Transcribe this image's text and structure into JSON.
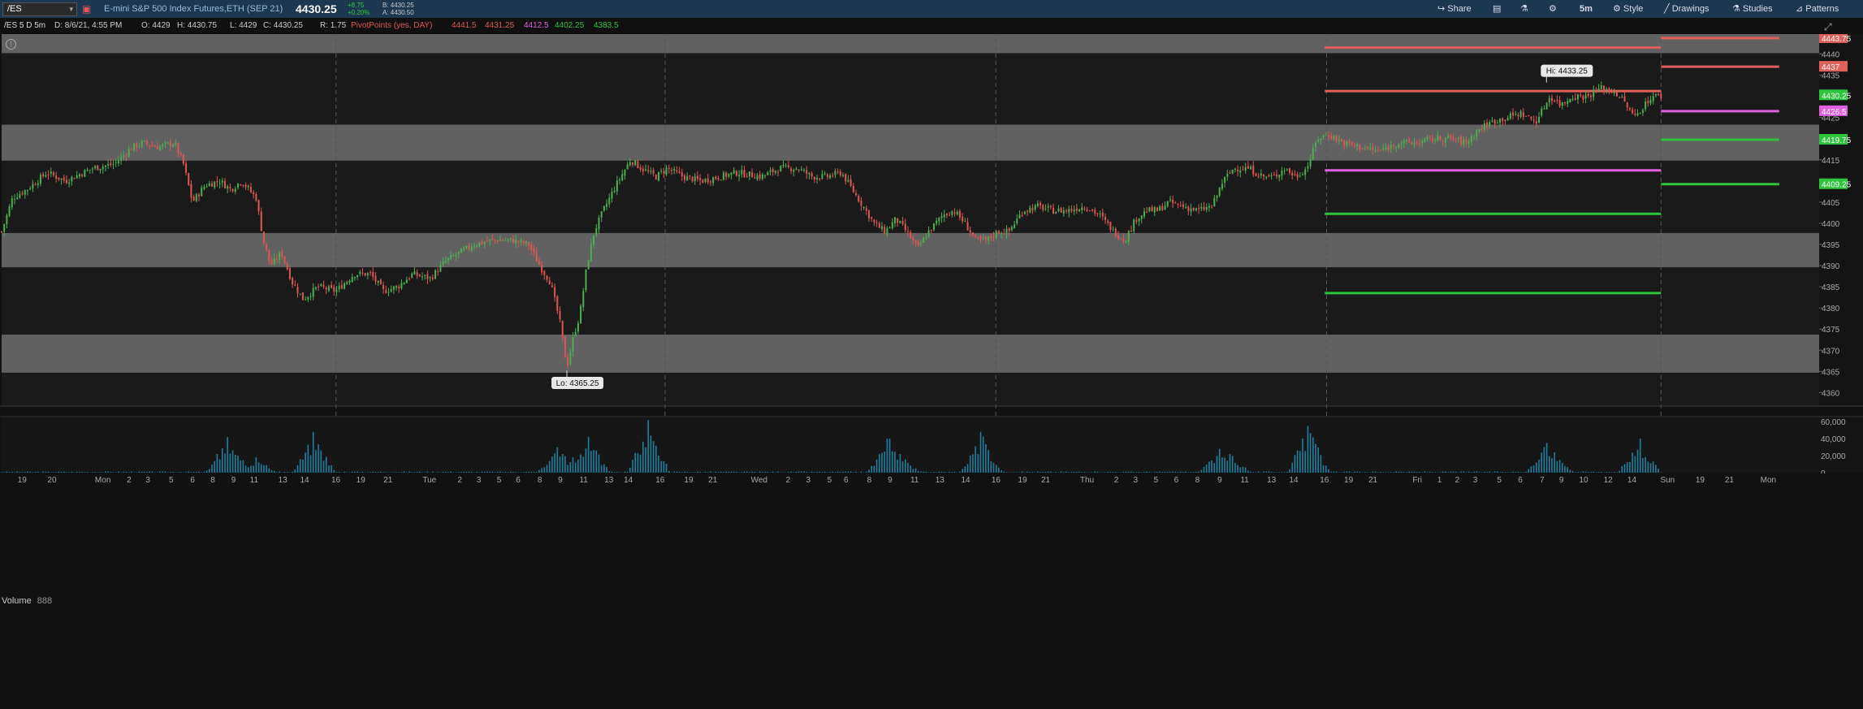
{
  "toolbar": {
    "symbol": "/ES",
    "description": "E-mini S&P 500 Index Futures,ETH (SEP 21)",
    "last_price": "4430.25",
    "net_change": "+8.75",
    "pct_change": "+0.20%",
    "bid": "B: 4430.25",
    "ask": "A: 4430.50",
    "buttons": [
      "Share",
      "5m",
      "Style",
      "Drawings",
      "Studies",
      "Patterns"
    ]
  },
  "infobar": {
    "chart_title": "/ES 5 D 5m",
    "date": "D: 8/6/21, 4:55 PM",
    "open": "O: 4429",
    "high": "H: 4430.75",
    "low": "L: 4429",
    "close": "C: 4430.25",
    "range": "R: 1.75",
    "study": "PivotPoints (yes, DAY)",
    "pivots": [
      "4441.5",
      "4431.25",
      "4412.5",
      "4402.25",
      "4383.5"
    ]
  },
  "volume": {
    "label": "Volume",
    "value": "888"
  },
  "colors": {
    "background": "#111111",
    "band": "#7a7a7a",
    "up": "#4caf50",
    "down": "#e05555",
    "resistance": "#e0605a",
    "pivot": "#e060e0",
    "support": "#2ec43c",
    "volume": "#1f7fa0",
    "toolbar": "#1c3750"
  },
  "chart_data": {
    "type": "candlestick",
    "ylim": [
      4357,
      4447
    ],
    "y_ticks": [
      "4440",
      "4435",
      "4430",
      "4425",
      "4420",
      "4415",
      "4410",
      "4405",
      "4400",
      "4395",
      "4390",
      "4385",
      "4380",
      "4375",
      "4370",
      "4365",
      "4360"
    ],
    "x_ticks": [
      {
        "label": "19",
        "x": 0.0113
      },
      {
        "label": "20",
        "x": 0.0277
      },
      {
        "label": "Mon",
        "x": 0.0557
      },
      {
        "label": "2",
        "x": 0.0701
      },
      {
        "label": "3",
        "x": 0.0805
      },
      {
        "label": "5",
        "x": 0.0933
      },
      {
        "label": "6",
        "x": 0.1051
      },
      {
        "label": "8",
        "x": 0.1162
      },
      {
        "label": "9",
        "x": 0.1276
      },
      {
        "label": "11",
        "x": 0.1389
      },
      {
        "label": "13",
        "x": 0.1547
      },
      {
        "label": "14",
        "x": 0.1667
      },
      {
        "label": "16",
        "x": 0.1839
      },
      {
        "label": "19",
        "x": 0.1976
      },
      {
        "label": "21",
        "x": 0.2126
      },
      {
        "label": "Tue",
        "x": 0.2354
      },
      {
        "label": "2",
        "x": 0.2521
      },
      {
        "label": "3",
        "x": 0.2626
      },
      {
        "label": "5",
        "x": 0.2737
      },
      {
        "label": "6",
        "x": 0.2842
      },
      {
        "label": "8",
        "x": 0.2961
      },
      {
        "label": "9",
        "x": 0.3074
      },
      {
        "label": "11",
        "x": 0.3202
      },
      {
        "label": "13",
        "x": 0.3341
      },
      {
        "label": "14",
        "x": 0.3448
      },
      {
        "label": "16",
        "x": 0.3623
      },
      {
        "label": "19",
        "x": 0.378
      },
      {
        "label": "21",
        "x": 0.3913
      },
      {
        "label": "Wed",
        "x": 0.4168
      },
      {
        "label": "2",
        "x": 0.4327
      },
      {
        "label": "3",
        "x": 0.4438
      },
      {
        "label": "5",
        "x": 0.4555
      },
      {
        "label": "6",
        "x": 0.4646
      },
      {
        "label": "8",
        "x": 0.4774
      },
      {
        "label": "9",
        "x": 0.4888
      },
      {
        "label": "11",
        "x": 0.5023
      },
      {
        "label": "13",
        "x": 0.5162
      },
      {
        "label": "14",
        "x": 0.5304
      },
      {
        "label": "16",
        "x": 0.5471
      },
      {
        "label": "19",
        "x": 0.5617
      },
      {
        "label": "21",
        "x": 0.5744
      },
      {
        "label": "Thu",
        "x": 0.5972
      },
      {
        "label": "2",
        "x": 0.6133
      },
      {
        "label": "3",
        "x": 0.6239
      },
      {
        "label": "5",
        "x": 0.6351
      },
      {
        "label": "6",
        "x": 0.6463
      },
      {
        "label": "8",
        "x": 0.6579
      },
      {
        "label": "9",
        "x": 0.6702
      },
      {
        "label": "11",
        "x": 0.6839
      },
      {
        "label": "13",
        "x": 0.6987
      },
      {
        "label": "14",
        "x": 0.7109
      },
      {
        "label": "16",
        "x": 0.7278
      },
      {
        "label": "19",
        "x": 0.7411
      },
      {
        "label": "21",
        "x": 0.7545
      },
      {
        "label": "Fri",
        "x": 0.7789
      },
      {
        "label": "1",
        "x": 0.7911
      },
      {
        "label": "2",
        "x": 0.8009
      },
      {
        "label": "3",
        "x": 0.8108
      },
      {
        "label": "5",
        "x": 0.824
      },
      {
        "label": "6",
        "x": 0.8356
      },
      {
        "label": "7",
        "x": 0.8476
      },
      {
        "label": "9",
        "x": 0.8582
      },
      {
        "label": "10",
        "x": 0.8704
      },
      {
        "label": "12",
        "x": 0.8839
      },
      {
        "label": "14",
        "x": 0.897
      },
      {
        "label": "Sun",
        "x": 0.9166
      },
      {
        "label": "19",
        "x": 0.9345
      },
      {
        "label": "21",
        "x": 0.9506
      },
      {
        "label": "Mon",
        "x": 0.972
      }
    ],
    "session_dividers": [
      0.184,
      0.365,
      0.547,
      0.729,
      0.913
    ],
    "gray_bands": [
      [
        4440.2,
        4447
      ],
      [
        4414.8,
        4423.3
      ],
      [
        4389.6,
        4397.7
      ],
      [
        4364.7,
        4373.7
      ]
    ],
    "pivot_lines": [
      {
        "value": 4441.5,
        "role": "resistance",
        "x0": 0.728,
        "x1": 0.913
      },
      {
        "value": 4431.25,
        "role": "resistance",
        "x0": 0.728,
        "x1": 0.913
      },
      {
        "value": 4412.5,
        "role": "pivot",
        "x0": 0.728,
        "x1": 0.913
      },
      {
        "value": 4402.25,
        "role": "support",
        "x0": 0.728,
        "x1": 0.913
      },
      {
        "value": 4383.5,
        "role": "support",
        "x0": 0.728,
        "x1": 0.913
      },
      {
        "value": 4443.75,
        "role": "resistance",
        "x0": 0.913,
        "x1": 0.978
      },
      {
        "value": 4437,
        "role": "resistance",
        "x0": 0.913,
        "x1": 0.978
      },
      {
        "value": 4426.5,
        "role": "pivot",
        "x0": 0.913,
        "x1": 0.978
      },
      {
        "value": 4419.75,
        "role": "support",
        "x0": 0.913,
        "x1": 0.978
      },
      {
        "value": 4409.25,
        "role": "support",
        "x0": 0.913,
        "x1": 0.978
      }
    ],
    "price_flags": [
      {
        "label": "4443.75",
        "value": 4443.75,
        "role": "resistance"
      },
      {
        "label": "4437",
        "value": 4437,
        "role": "resistance"
      },
      {
        "label": "4430.25",
        "value": 4430.25,
        "role": "support"
      },
      {
        "label": "4426.5",
        "value": 4426.5,
        "role": "pivot"
      },
      {
        "label": "4419.75",
        "value": 4419.75,
        "role": "support"
      },
      {
        "label": "4409.25",
        "value": 4409.25,
        "role": "support"
      }
    ],
    "annotations": [
      {
        "text": "Hi: 4433.25",
        "x": 0.85,
        "value": 4433.25
      },
      {
        "text": "Lo: 4365.25",
        "x": 0.311,
        "value": 4365.25
      }
    ],
    "price_path": [
      [
        0.0,
        4398
      ],
      [
        0.006,
        4406
      ],
      [
        0.014,
        4408
      ],
      [
        0.025,
        4412
      ],
      [
        0.035,
        4410
      ],
      [
        0.05,
        4413
      ],
      [
        0.062,
        4414
      ],
      [
        0.072,
        4418
      ],
      [
        0.078,
        4419
      ],
      [
        0.086,
        4418
      ],
      [
        0.095,
        4419
      ],
      [
        0.1,
        4414
      ],
      [
        0.105,
        4405
      ],
      [
        0.112,
        4409
      ],
      [
        0.12,
        4410
      ],
      [
        0.126,
        4408
      ],
      [
        0.132,
        4410
      ],
      [
        0.14,
        4406
      ],
      [
        0.144,
        4396
      ],
      [
        0.148,
        4390
      ],
      [
        0.154,
        4393
      ],
      [
        0.16,
        4386
      ],
      [
        0.166,
        4382
      ],
      [
        0.174,
        4385
      ],
      [
        0.184,
        4384
      ],
      [
        0.194,
        4388
      ],
      [
        0.203,
        4388
      ],
      [
        0.21,
        4384
      ],
      [
        0.218,
        4385
      ],
      [
        0.226,
        4388
      ],
      [
        0.236,
        4387
      ],
      [
        0.244,
        4391
      ],
      [
        0.252,
        4393
      ],
      [
        0.26,
        4395
      ],
      [
        0.27,
        4396
      ],
      [
        0.28,
        4396
      ],
      [
        0.29,
        4395
      ],
      [
        0.296,
        4390
      ],
      [
        0.302,
        4386
      ],
      [
        0.307,
        4377
      ],
      [
        0.311,
        4366
      ],
      [
        0.315,
        4374
      ],
      [
        0.318,
        4378
      ],
      [
        0.322,
        4390
      ],
      [
        0.326,
        4398
      ],
      [
        0.331,
        4403
      ],
      [
        0.338,
        4409
      ],
      [
        0.346,
        4415
      ],
      [
        0.352,
        4413
      ],
      [
        0.36,
        4411
      ],
      [
        0.366,
        4413
      ],
      [
        0.375,
        4411
      ],
      [
        0.385,
        4410
      ],
      [
        0.395,
        4411
      ],
      [
        0.405,
        4412
      ],
      [
        0.418,
        4411
      ],
      [
        0.428,
        4413
      ],
      [
        0.438,
        4413
      ],
      [
        0.446,
        4411
      ],
      [
        0.454,
        4411
      ],
      [
        0.462,
        4412
      ],
      [
        0.468,
        4408
      ],
      [
        0.474,
        4404
      ],
      [
        0.48,
        4400
      ],
      [
        0.486,
        4398
      ],
      [
        0.492,
        4401
      ],
      [
        0.498,
        4398
      ],
      [
        0.504,
        4394
      ],
      [
        0.51,
        4398
      ],
      [
        0.518,
        4402
      ],
      [
        0.524,
        4403
      ],
      [
        0.53,
        4400
      ],
      [
        0.536,
        4396
      ],
      [
        0.542,
        4396
      ],
      [
        0.548,
        4398
      ],
      [
        0.554,
        4398
      ],
      [
        0.562,
        4403
      ],
      [
        0.57,
        4404
      ],
      [
        0.578,
        4403
      ],
      [
        0.586,
        4403
      ],
      [
        0.596,
        4404
      ],
      [
        0.604,
        4402
      ],
      [
        0.612,
        4398
      ],
      [
        0.618,
        4396
      ],
      [
        0.624,
        4401
      ],
      [
        0.63,
        4403
      ],
      [
        0.636,
        4403
      ],
      [
        0.642,
        4405
      ],
      [
        0.65,
        4404
      ],
      [
        0.658,
        4403
      ],
      [
        0.666,
        4404
      ],
      [
        0.672,
        4410
      ],
      [
        0.678,
        4413
      ],
      [
        0.686,
        4413
      ],
      [
        0.694,
        4411
      ],
      [
        0.7,
        4411
      ],
      [
        0.706,
        4413
      ],
      [
        0.712,
        4411
      ],
      [
        0.718,
        4413
      ],
      [
        0.724,
        4420
      ],
      [
        0.73,
        4421
      ],
      [
        0.738,
        4419
      ],
      [
        0.748,
        4418
      ],
      [
        0.758,
        4417
      ],
      [
        0.768,
        4419
      ],
      [
        0.778,
        4419
      ],
      [
        0.788,
        4420
      ],
      [
        0.798,
        4420
      ],
      [
        0.806,
        4419
      ],
      [
        0.812,
        4422
      ],
      [
        0.82,
        4424
      ],
      [
        0.828,
        4425
      ],
      [
        0.836,
        4426
      ],
      [
        0.844,
        4424
      ],
      [
        0.848,
        4427
      ],
      [
        0.852,
        4430
      ],
      [
        0.858,
        4428
      ],
      [
        0.864,
        4430
      ],
      [
        0.872,
        4430
      ],
      [
        0.88,
        4432
      ],
      [
        0.888,
        4431
      ],
      [
        0.894,
        4428
      ],
      [
        0.898,
        4425
      ],
      [
        0.902,
        4427
      ],
      [
        0.908,
        4430
      ],
      [
        0.913,
        4430
      ]
    ],
    "volume_ylim": [
      0,
      65000
    ],
    "volume_ticks": [
      "60,000",
      "40,000",
      "20,000",
      "0"
    ],
    "volume_spikes": [
      {
        "x": 0.124,
        "v": 42000
      },
      {
        "x": 0.13,
        "v": 20000
      },
      {
        "x": 0.14,
        "v": 18000
      },
      {
        "x": 0.172,
        "v": 48000
      },
      {
        "x": 0.306,
        "v": 30000
      },
      {
        "x": 0.314,
        "v": 18000
      },
      {
        "x": 0.323,
        "v": 42000
      },
      {
        "x": 0.356,
        "v": 62000
      },
      {
        "x": 0.488,
        "v": 40000
      },
      {
        "x": 0.494,
        "v": 22000
      },
      {
        "x": 0.539,
        "v": 48000
      },
      {
        "x": 0.67,
        "v": 28000
      },
      {
        "x": 0.676,
        "v": 22000
      },
      {
        "x": 0.719,
        "v": 55000
      },
      {
        "x": 0.85,
        "v": 35000
      },
      {
        "x": 0.854,
        "v": 24000
      },
      {
        "x": 0.901,
        "v": 40000
      }
    ]
  }
}
